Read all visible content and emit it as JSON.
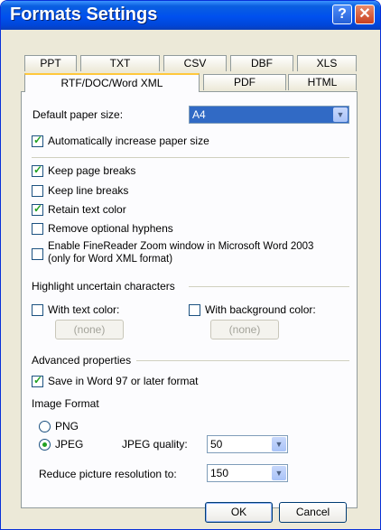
{
  "window": {
    "title": "Formats Settings",
    "help_label": "?",
    "close_label": "✕"
  },
  "tabs": {
    "row1": [
      "PPT",
      "TXT",
      "CSV",
      "DBF",
      "XLS"
    ],
    "row2": [
      "RTF/DOC/Word XML",
      "PDF",
      "HTML"
    ],
    "active": "RTF/DOC/Word XML"
  },
  "paper": {
    "label": "Default paper size:",
    "value": "A4"
  },
  "options": {
    "auto_increase": {
      "label": "Automatically increase paper size",
      "checked": true
    },
    "keep_page_breaks": {
      "label": "Keep page breaks",
      "checked": true
    },
    "keep_line_breaks": {
      "label": "Keep line breaks",
      "checked": false
    },
    "retain_text_color": {
      "label": "Retain text color",
      "checked": true
    },
    "remove_hyphens": {
      "label": "Remove optional hyphens",
      "checked": false
    },
    "finereader_zoom": {
      "label_line1": "Enable FineReader Zoom window in Microsoft Word 2003",
      "label_line2": "(only for Word XML format)",
      "checked": false
    }
  },
  "highlight": {
    "title": "Highlight uncertain characters",
    "text_color": {
      "label": "With text color:",
      "button": "(none)",
      "checked": false
    },
    "bg_color": {
      "label": "With background color:",
      "button": "(none)",
      "checked": false
    }
  },
  "advanced": {
    "title": "Advanced properties",
    "save_word97": {
      "label": "Save in Word 97 or later format",
      "checked": true
    }
  },
  "image_format": {
    "title": "Image Format",
    "png": {
      "label": "PNG",
      "selected": false
    },
    "jpeg": {
      "label": "JPEG",
      "selected": true
    },
    "quality_label": "JPEG quality:",
    "quality_value": "50",
    "resolution_label": "Reduce picture resolution to:",
    "resolution_value": "150"
  },
  "buttons": {
    "ok": "OK",
    "cancel": "Cancel"
  },
  "colors": {
    "title_bar": "#0050ee",
    "panel_bg": "#fcfcfe",
    "dialog_bg": "#ece9d8",
    "check": "#21a121",
    "select_highlight": "#316ac5"
  }
}
